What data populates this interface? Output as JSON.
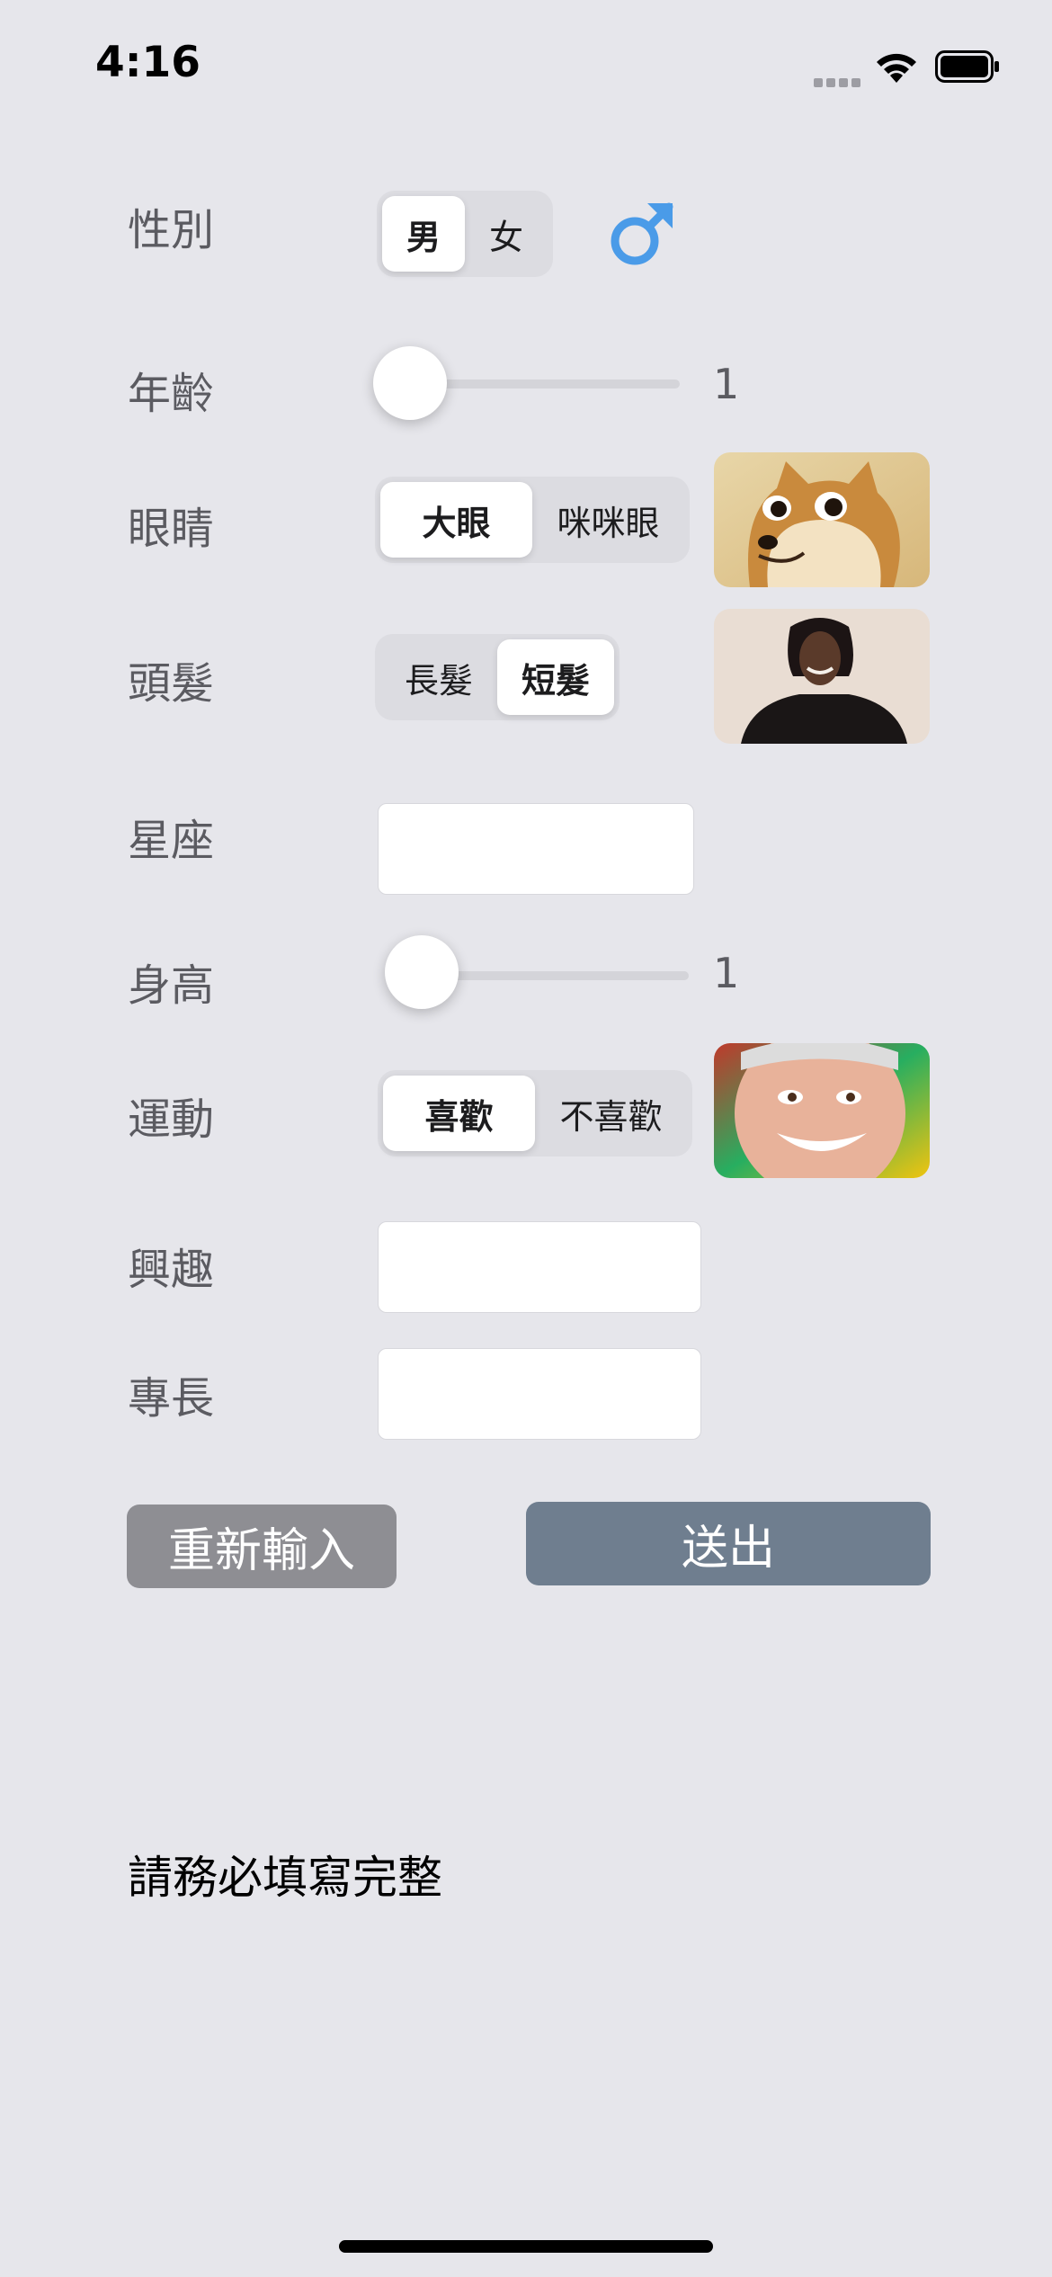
{
  "status_bar": {
    "time": "4:16"
  },
  "form": {
    "gender": {
      "label": "性別",
      "options": [
        "男",
        "女"
      ],
      "selected": "男",
      "symbol_icon": "male-symbol-icon",
      "symbol_color": "#4a9be8"
    },
    "age": {
      "label": "年齡",
      "value": "1"
    },
    "eyes": {
      "label": "眼睛",
      "options": [
        "大眼",
        "咪咪眼"
      ],
      "selected": "大眼",
      "image": "doge-meme-image"
    },
    "hair": {
      "label": "頭髮",
      "options": [
        "長髮",
        "短髮"
      ],
      "selected": "短髮",
      "image": "person-short-hair-image"
    },
    "zodiac": {
      "label": "星座",
      "value": ""
    },
    "height": {
      "label": "身高",
      "value": "1"
    },
    "sports": {
      "label": "運動",
      "options": [
        "喜歡",
        "不喜歡"
      ],
      "selected": "喜歡",
      "image": "smiling-man-meme-image"
    },
    "interest": {
      "label": "興趣",
      "value": ""
    },
    "skill": {
      "label": "專長",
      "value": ""
    }
  },
  "buttons": {
    "reset": "重新輸入",
    "submit": "送出"
  },
  "message": "請務必填寫完整",
  "colors": {
    "background": "#e6e6eb",
    "reset_button": "#8e8e93",
    "submit_button": "#6f7e8f",
    "accent": "#4a9be8"
  }
}
